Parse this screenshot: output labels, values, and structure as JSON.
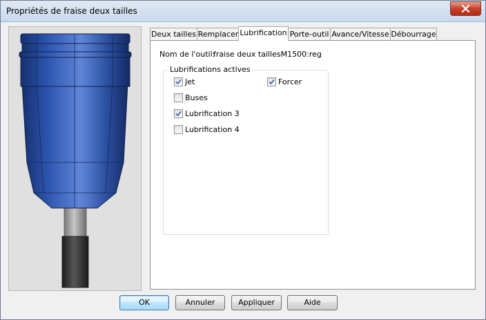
{
  "window": {
    "title": "Propriétés de fraise deux tailles"
  },
  "tabs": [
    {
      "label": "Deux tailles",
      "active": false
    },
    {
      "label": "Remplacer",
      "active": false
    },
    {
      "label": "Lubrification",
      "active": true
    },
    {
      "label": "Porte-outil",
      "active": false
    },
    {
      "label": "Avance/Vitesse",
      "active": false
    },
    {
      "label": "Débourrage",
      "active": false
    }
  ],
  "tool": {
    "name_label": "Nom de l'outil:",
    "name_value": "fraise deux taillesM1500:reg"
  },
  "lubrication": {
    "group_title": "Lubrifications actives",
    "options": [
      {
        "label": "Jet",
        "checked": true
      },
      {
        "label": "Forcer",
        "checked": true
      },
      {
        "label": "Buses",
        "checked": false
      },
      {
        "label": "Lubrification 3",
        "checked": true
      },
      {
        "label": "Lubrification 4",
        "checked": false
      }
    ]
  },
  "buttons": {
    "ok": "OK",
    "cancel": "Annuler",
    "apply": "Appliquer",
    "help": "Aide"
  },
  "colors": {
    "tool_body": "#1f3d8f",
    "tool_highlight": "#4f7ad0",
    "shank": "#8f8f8f",
    "shank_dark": "#2d2d2d",
    "accent": "#3c7fb1"
  }
}
